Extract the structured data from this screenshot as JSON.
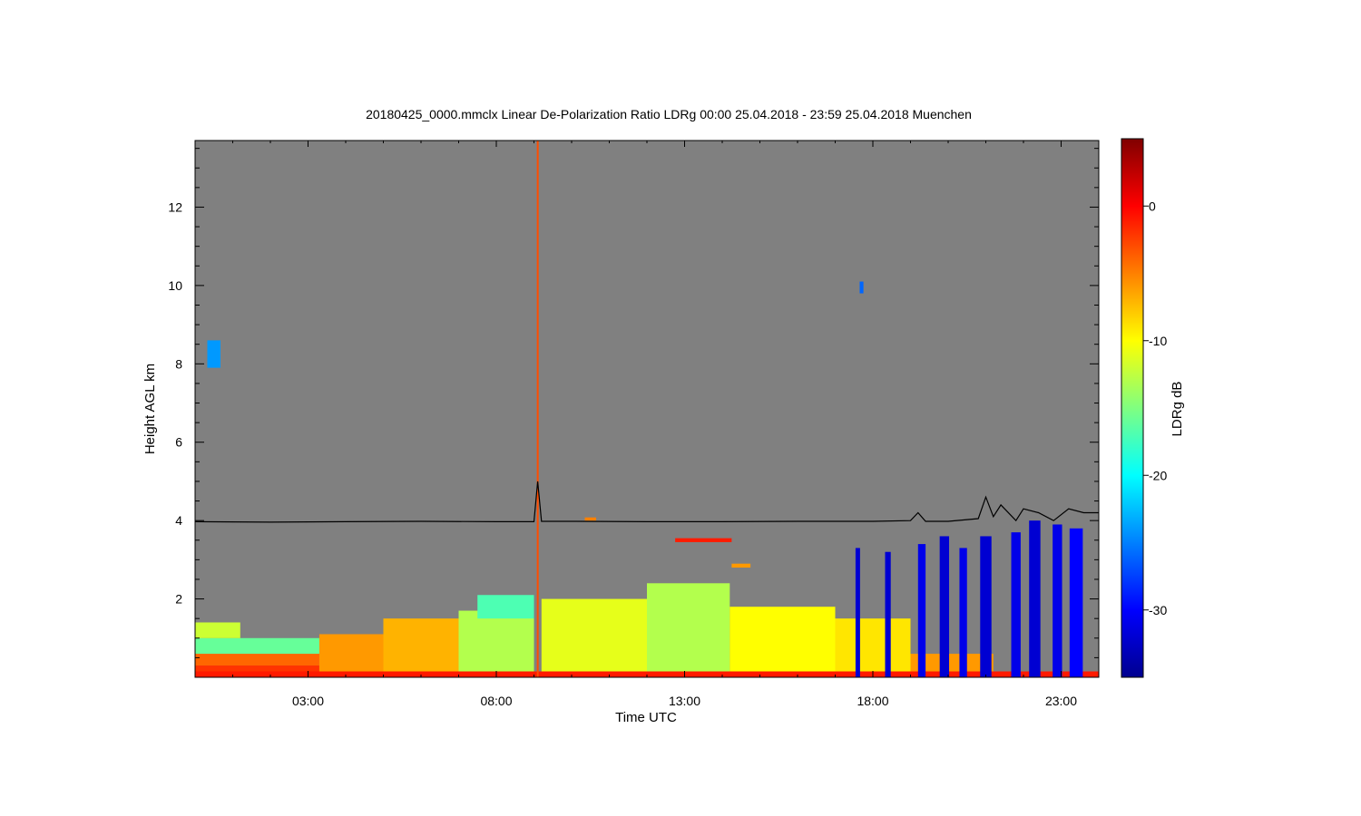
{
  "chart_data": {
    "type": "heatmap",
    "title": "20180425_0000.mmclx Linear De-Polarization Ratio LDRg   00:00 25.04.2018 - 23:59 25.04.2018 Muenchen",
    "xlabel": "Time UTC",
    "ylabel": "Height AGL km",
    "colorbar_label": "LDRg dB",
    "x_unit": "hours UTC",
    "xlim": [
      0,
      24
    ],
    "ylim": [
      0,
      13.7
    ],
    "x_ticks": [
      {
        "value": 3,
        "label": "03:00"
      },
      {
        "value": 8,
        "label": "08:00"
      },
      {
        "value": 13,
        "label": "13:00"
      },
      {
        "value": 18,
        "label": "18:00"
      },
      {
        "value": 23,
        "label": "23:00"
      }
    ],
    "y_ticks": [
      {
        "value": 2,
        "label": "2"
      },
      {
        "value": 4,
        "label": "4"
      },
      {
        "value": 6,
        "label": "6"
      },
      {
        "value": 8,
        "label": "8"
      },
      {
        "value": 10,
        "label": "10"
      },
      {
        "value": 12,
        "label": "12"
      }
    ],
    "colorbar_range": [
      -35,
      5
    ],
    "colorbar_ticks": [
      {
        "value": 0,
        "label": "0"
      },
      {
        "value": -10,
        "label": "-10"
      },
      {
        "value": -20,
        "label": "-20"
      },
      {
        "value": -30,
        "label": "-30"
      }
    ],
    "colormap": [
      "#00008f",
      "#0000ff",
      "#0080ff",
      "#00ffff",
      "#80ff80",
      "#ffff00",
      "#ff8000",
      "#ff0000",
      "#800000"
    ],
    "background_color": "#808080",
    "regions": [
      {
        "t0": 0.0,
        "t1": 3.3,
        "h0": 0.0,
        "h1": 0.3,
        "ldr": -2
      },
      {
        "t0": 0.0,
        "t1": 3.3,
        "h0": 0.3,
        "h1": 0.6,
        "ldr": -4
      },
      {
        "t0": 0.0,
        "t1": 3.3,
        "h0": 0.6,
        "h1": 1.0,
        "ldr": -16
      },
      {
        "t0": 0.0,
        "t1": 1.2,
        "h0": 1.0,
        "h1": 1.4,
        "ldr": -12
      },
      {
        "t0": 3.3,
        "t1": 5.0,
        "h0": 0.0,
        "h1": 1.1,
        "ldr": -6
      },
      {
        "t0": 5.0,
        "t1": 7.0,
        "h0": 0.0,
        "h1": 1.5,
        "ldr": -7
      },
      {
        "t0": 7.0,
        "t1": 9.0,
        "h0": 0.0,
        "h1": 1.7,
        "ldr": -13
      },
      {
        "t0": 7.5,
        "t1": 9.0,
        "h0": 1.5,
        "h1": 2.1,
        "ldr": -17
      },
      {
        "t0": 9.2,
        "t1": 12.0,
        "h0": 0.0,
        "h1": 2.0,
        "ldr": -11
      },
      {
        "t0": 12.0,
        "t1": 14.2,
        "h0": 0.0,
        "h1": 2.4,
        "ldr": -13
      },
      {
        "t0": 14.2,
        "t1": 17.0,
        "h0": 0.0,
        "h1": 1.8,
        "ldr": -10
      },
      {
        "t0": 17.0,
        "t1": 19.0,
        "h0": 0.0,
        "h1": 1.5,
        "ldr": -9
      },
      {
        "t0": 19.0,
        "t1": 21.2,
        "h0": 0.0,
        "h1": 0.6,
        "ldr": -6
      },
      {
        "t0": 0.0,
        "t1": 24.0,
        "h0": 0.0,
        "h1": 0.15,
        "ldr": -1
      }
    ],
    "precipitation_streaks": [
      {
        "t": 17.6,
        "w": 0.12,
        "h1": 3.3,
        "ldr": -32
      },
      {
        "t": 18.4,
        "w": 0.15,
        "h1": 3.2,
        "ldr": -32
      },
      {
        "t": 19.3,
        "w": 0.2,
        "h1": 3.4,
        "ldr": -31
      },
      {
        "t": 19.9,
        "w": 0.25,
        "h1": 3.6,
        "ldr": -32
      },
      {
        "t": 20.4,
        "w": 0.2,
        "h1": 3.3,
        "ldr": -31
      },
      {
        "t": 21.0,
        "w": 0.3,
        "h1": 3.6,
        "ldr": -32
      },
      {
        "t": 21.8,
        "w": 0.25,
        "h1": 3.7,
        "ldr": -31
      },
      {
        "t": 22.3,
        "w": 0.3,
        "h1": 4.0,
        "ldr": -32
      },
      {
        "t": 22.9,
        "w": 0.25,
        "h1": 3.9,
        "ldr": -31
      },
      {
        "t": 23.4,
        "w": 0.35,
        "h1": 3.8,
        "ldr": -30
      }
    ],
    "small_echoes": [
      {
        "t": 0.5,
        "w": 0.35,
        "h0": 7.9,
        "h1": 8.6,
        "ldr": -24
      },
      {
        "t": 17.7,
        "w": 0.1,
        "h0": 9.8,
        "h1": 10.1,
        "ldr": -26
      },
      {
        "t": 10.5,
        "w": 0.3,
        "h0": 4.0,
        "h1": 4.08,
        "ldr": -5
      },
      {
        "t": 13.5,
        "w": 1.5,
        "h0": 3.45,
        "h1": 3.55,
        "ldr": -1
      },
      {
        "t": 14.5,
        "w": 0.5,
        "h0": 2.8,
        "h1": 2.9,
        "ldr": -6
      }
    ],
    "vertical_spike": {
      "t": 9.1,
      "h0": 0.0,
      "h1": 13.7,
      "ldr": -3
    },
    "cloud_top_line": {
      "color": "#000000",
      "t": [
        0,
        2,
        4,
        6,
        8,
        9.0,
        9.1,
        9.2,
        10,
        12,
        14,
        16,
        18,
        19.0,
        19.2,
        19.4,
        20,
        20.8,
        21.0,
        21.2,
        21.4,
        21.8,
        22.0,
        22.4,
        22.8,
        23.2,
        23.6,
        24
      ],
      "h": [
        3.97,
        3.96,
        3.97,
        3.98,
        3.97,
        3.97,
        5.0,
        3.98,
        3.98,
        3.97,
        3.97,
        3.98,
        3.98,
        4.0,
        4.2,
        3.98,
        3.98,
        4.05,
        4.6,
        4.1,
        4.4,
        4.0,
        4.3,
        4.2,
        4.0,
        4.3,
        4.2,
        4.2
      ]
    }
  }
}
